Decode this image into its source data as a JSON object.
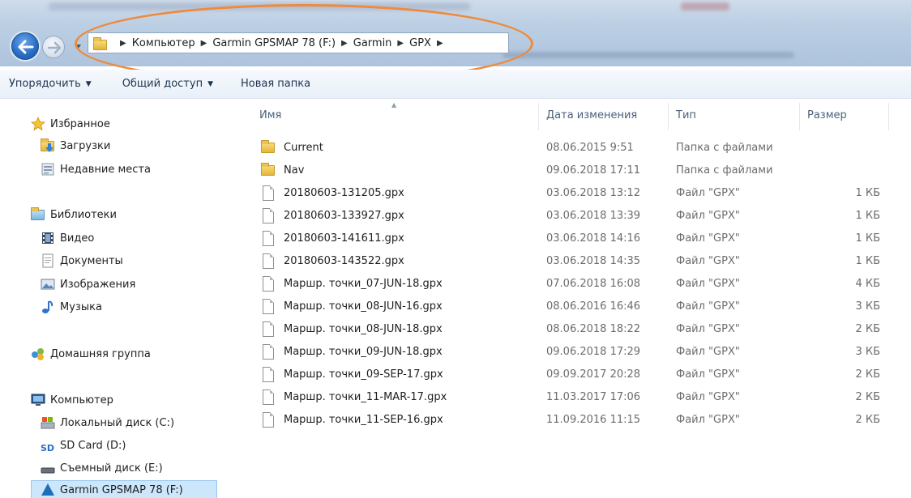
{
  "address": {
    "crumbs": [
      "Компьютер",
      "Garmin GPSMAP 78 (F:)",
      "Garmin",
      "GPX"
    ]
  },
  "toolbar": {
    "organize_label": "Упорядочить",
    "share_label": "Общий доступ",
    "new_folder_label": "Новая папка"
  },
  "sidebar": {
    "favorites": "Избранное",
    "downloads": "Загрузки",
    "recent": "Недавние места",
    "libraries": "Библиотеки",
    "video": "Видео",
    "documents": "Документы",
    "images": "Изображения",
    "music": "Музыка",
    "homegroup": "Домашняя группа",
    "computer": "Компьютер",
    "local_disk": "Локальный диск (C:)",
    "sd_card": "SD Card (D:)",
    "removable": "Съемный диск (E:)",
    "garmin": "Garmin GPSMAP 78 (F:)"
  },
  "columns": {
    "name": "Имя",
    "date": "Дата изменения",
    "type": "Тип",
    "size": "Размер"
  },
  "files": [
    {
      "name": "Current",
      "date": "08.06.2015 9:51",
      "type": "Папка с файлами",
      "size": "",
      "kind": "folder"
    },
    {
      "name": "Nav",
      "date": "09.06.2018 17:11",
      "type": "Папка с файлами",
      "size": "",
      "kind": "folder"
    },
    {
      "name": "20180603-131205.gpx",
      "date": "03.06.2018 13:12",
      "type": "Файл \"GPX\"",
      "size": "1 КБ",
      "kind": "file"
    },
    {
      "name": "20180603-133927.gpx",
      "date": "03.06.2018 13:39",
      "type": "Файл \"GPX\"",
      "size": "1 КБ",
      "kind": "file"
    },
    {
      "name": "20180603-141611.gpx",
      "date": "03.06.2018 14:16",
      "type": "Файл \"GPX\"",
      "size": "1 КБ",
      "kind": "file"
    },
    {
      "name": "20180603-143522.gpx",
      "date": "03.06.2018 14:35",
      "type": "Файл \"GPX\"",
      "size": "1 КБ",
      "kind": "file"
    },
    {
      "name": "Маршр. точки_07-JUN-18.gpx",
      "date": "07.06.2018 16:08",
      "type": "Файл \"GPX\"",
      "size": "4 КБ",
      "kind": "file"
    },
    {
      "name": "Маршр. точки_08-JUN-16.gpx",
      "date": "08.06.2016 16:46",
      "type": "Файл \"GPX\"",
      "size": "3 КБ",
      "kind": "file"
    },
    {
      "name": "Маршр. точки_08-JUN-18.gpx",
      "date": "08.06.2018 18:22",
      "type": "Файл \"GPX\"",
      "size": "2 КБ",
      "kind": "file"
    },
    {
      "name": "Маршр. точки_09-JUN-18.gpx",
      "date": "09.06.2018 17:29",
      "type": "Файл \"GPX\"",
      "size": "3 КБ",
      "kind": "file"
    },
    {
      "name": "Маршр. точки_09-SEP-17.gpx",
      "date": "09.09.2017 20:28",
      "type": "Файл \"GPX\"",
      "size": "2 КБ",
      "kind": "file"
    },
    {
      "name": "Маршр. точки_11-MAR-17.gpx",
      "date": "11.03.2017 17:06",
      "type": "Файл \"GPX\"",
      "size": "2 КБ",
      "kind": "file"
    },
    {
      "name": "Маршр. точки_11-SEP-16.gpx",
      "date": "11.09.2016 11:15",
      "type": "Файл \"GPX\"",
      "size": "2 КБ",
      "kind": "file"
    }
  ],
  "colors": {
    "highlight": "#ef8a3a",
    "selection": "#cce6fb",
    "toolbar_text": "#1e3553"
  }
}
